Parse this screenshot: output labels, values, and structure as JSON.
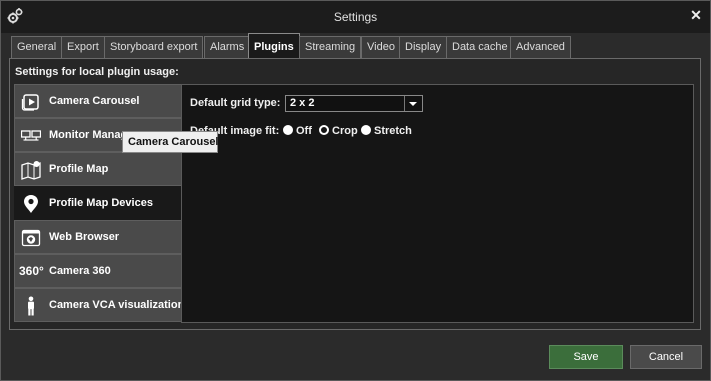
{
  "window": {
    "title": "Settings",
    "app_icon": "gears-icon",
    "close_icon": "close-icon"
  },
  "tabs": [
    {
      "label": "General"
    },
    {
      "label": "Export"
    },
    {
      "label": "Storyboard export"
    },
    {
      "label": "Alarms"
    },
    {
      "label": "Plugins",
      "active": true
    },
    {
      "label": "Streaming"
    },
    {
      "label": "Video"
    },
    {
      "label": "Display"
    },
    {
      "label": "Data cache"
    },
    {
      "label": "Advanced"
    }
  ],
  "panel": {
    "heading": "Settings for local plugin usage:"
  },
  "plugins": [
    {
      "label": "Camera Carousel",
      "icon": "camera-carousel-icon"
    },
    {
      "label": "Monitor Manager",
      "icon": "monitor-icon"
    },
    {
      "label": "Profile Map",
      "icon": "map-icon"
    },
    {
      "label": "Profile Map Devices",
      "icon": "map-pin-icon",
      "active": true
    },
    {
      "label": "Web Browser",
      "icon": "web-browser-icon"
    },
    {
      "label": "Camera 360",
      "icon": "camera-360-icon"
    },
    {
      "label": "Camera VCA visualization",
      "icon": "person-icon"
    }
  ],
  "settings": {
    "grid_label": "Default grid type:",
    "grid_value": "2 x 2",
    "fit_label": "Default image fit:",
    "fit_options": [
      {
        "label": "Off",
        "selected": true
      },
      {
        "label": "Crop",
        "selected": false
      },
      {
        "label": "Stretch",
        "selected": true
      }
    ]
  },
  "tooltip": {
    "text": "Camera Carousel"
  },
  "buttons": {
    "save": "Save",
    "cancel": "Cancel"
  },
  "colors": {
    "save_bg": "#3b6e3b",
    "panel_bg": "#262626",
    "content_bg": "#151515",
    "active_tab_bg": "#1a1a1a"
  }
}
